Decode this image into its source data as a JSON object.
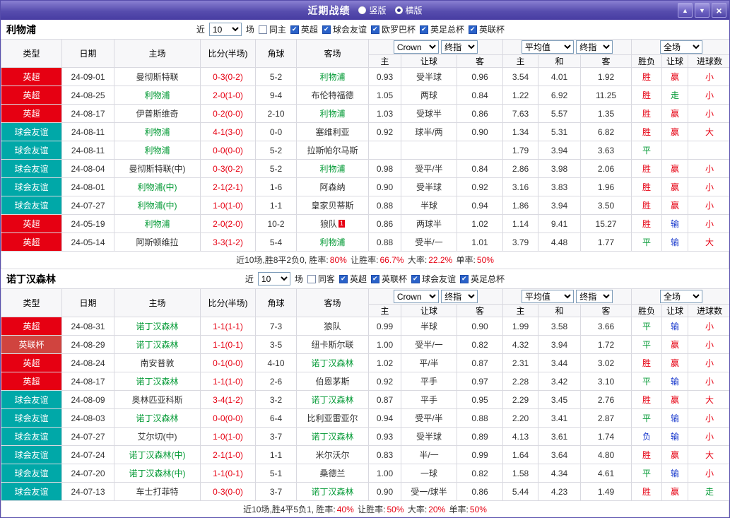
{
  "titlebar": {
    "title": "近期战绩",
    "vertical_label": "竖版",
    "horizontal_label": "横版",
    "selected_layout": "横版"
  },
  "icons": {
    "up": "▲",
    "down": "▼",
    "close": "×"
  },
  "colors": {
    "red": "#e60012",
    "green": "#009933",
    "blue": "#1536cc",
    "teal": "#00a8a8",
    "accent": "#574dae"
  },
  "columns": {
    "type": "类型",
    "date": "日期",
    "home": "主场",
    "score": "比分(半场)",
    "corner": "角球",
    "away": "客场",
    "odds_home": "主",
    "odds_handicap": "让球",
    "odds_away": "客",
    "avg_home": "主",
    "avg_draw": "和",
    "avg_away": "客",
    "result": "胜负",
    "handicap_result": "让球",
    "goals": "进球数"
  },
  "controls": {
    "near_label": "近",
    "near_value": "10",
    "games_label": "场",
    "bookmaker": "Crown",
    "final_index_1": "终指",
    "average": "平均值",
    "final_index_2": "终指",
    "scope": "全场"
  },
  "sections": [
    {
      "team": "利物浦",
      "same_filter": "同主",
      "leagues": [
        "英超",
        "球会友谊",
        "欧罗巴杯",
        "英足总杯",
        "英联杯"
      ],
      "rows": [
        {
          "league": "英超",
          "league_color": "#e60012",
          "date": "24-09-01",
          "home": "曼彻斯特联",
          "home_focus": false,
          "score": "0-3(0-2)",
          "corner": "5-2",
          "away": "利物浦",
          "away_focus": true,
          "away_badge": "",
          "o1": "0.93",
          "hcap": "受半球",
          "o2": "0.96",
          "m1": "3.54",
          "m2": "4.01",
          "m3": "1.92",
          "result": "胜",
          "hres": "赢",
          "goals": "小"
        },
        {
          "league": "英超",
          "league_color": "#e60012",
          "date": "24-08-25",
          "home": "利物浦",
          "home_focus": true,
          "score": "2-0(1-0)",
          "corner": "9-4",
          "away": "布伦特福德",
          "away_focus": false,
          "away_badge": "",
          "o1": "1.05",
          "hcap": "两球",
          "o2": "0.84",
          "m1": "1.22",
          "m2": "6.92",
          "m3": "11.25",
          "result": "胜",
          "hres": "走",
          "goals": "小"
        },
        {
          "league": "英超",
          "league_color": "#e60012",
          "date": "24-08-17",
          "home": "伊普斯维奇",
          "home_focus": false,
          "score": "0-2(0-0)",
          "corner": "2-10",
          "away": "利物浦",
          "away_focus": true,
          "away_badge": "",
          "o1": "1.03",
          "hcap": "受球半",
          "o2": "0.86",
          "m1": "7.63",
          "m2": "5.57",
          "m3": "1.35",
          "result": "胜",
          "hres": "赢",
          "goals": "小"
        },
        {
          "league": "球会友谊",
          "league_color": "#00a8a8",
          "date": "24-08-11",
          "home": "利物浦",
          "home_focus": true,
          "score": "4-1(3-0)",
          "corner": "0-0",
          "away": "塞维利亚",
          "away_focus": false,
          "away_badge": "",
          "o1": "0.92",
          "hcap": "球半/两",
          "o2": "0.90",
          "m1": "1.34",
          "m2": "5.31",
          "m3": "6.82",
          "result": "胜",
          "hres": "赢",
          "goals": "大"
        },
        {
          "league": "球会友谊",
          "league_color": "#00a8a8",
          "date": "24-08-11",
          "home": "利物浦",
          "home_focus": true,
          "score": "0-0(0-0)",
          "corner": "5-2",
          "away": "拉斯帕尔马斯",
          "away_focus": false,
          "away_badge": "",
          "o1": "",
          "hcap": "",
          "o2": "",
          "m1": "1.79",
          "m2": "3.94",
          "m3": "3.63",
          "result": "平",
          "hres": "",
          "goals": ""
        },
        {
          "league": "球会友谊",
          "league_color": "#00a8a8",
          "date": "24-08-04",
          "home": "曼彻斯特联(中)",
          "home_focus": false,
          "score": "0-3(0-2)",
          "corner": "5-2",
          "away": "利物浦",
          "away_focus": true,
          "away_badge": "",
          "o1": "0.98",
          "hcap": "受平/半",
          "o2": "0.84",
          "m1": "2.86",
          "m2": "3.98",
          "m3": "2.06",
          "result": "胜",
          "hres": "赢",
          "goals": "小"
        },
        {
          "league": "球会友谊",
          "league_color": "#00a8a8",
          "date": "24-08-01",
          "home": "利物浦(中)",
          "home_focus": true,
          "score": "2-1(2-1)",
          "corner": "1-6",
          "away": "阿森纳",
          "away_focus": false,
          "away_badge": "",
          "o1": "0.90",
          "hcap": "受半球",
          "o2": "0.92",
          "m1": "3.16",
          "m2": "3.83",
          "m3": "1.96",
          "result": "胜",
          "hres": "赢",
          "goals": "小"
        },
        {
          "league": "球会友谊",
          "league_color": "#00a8a8",
          "date": "24-07-27",
          "home": "利物浦(中)",
          "home_focus": true,
          "score": "1-0(1-0)",
          "corner": "1-1",
          "away": "皇家贝蒂斯",
          "away_focus": false,
          "away_badge": "",
          "o1": "0.88",
          "hcap": "半球",
          "o2": "0.94",
          "m1": "1.86",
          "m2": "3.94",
          "m3": "3.50",
          "result": "胜",
          "hres": "赢",
          "goals": "小"
        },
        {
          "league": "英超",
          "league_color": "#e60012",
          "date": "24-05-19",
          "home": "利物浦",
          "home_focus": true,
          "score": "2-0(2-0)",
          "corner": "10-2",
          "away": "狼队",
          "away_focus": false,
          "away_badge": "1",
          "o1": "0.86",
          "hcap": "两球半",
          "o2": "1.02",
          "m1": "1.14",
          "m2": "9.41",
          "m3": "15.27",
          "result": "胜",
          "hres": "输",
          "goals": "小"
        },
        {
          "league": "英超",
          "league_color": "#e60012",
          "date": "24-05-14",
          "home": "阿斯顿维拉",
          "home_focus": false,
          "score": "3-3(1-2)",
          "corner": "5-4",
          "away": "利物浦",
          "away_focus": true,
          "away_badge": "",
          "o1": "0.88",
          "hcap": "受半/一",
          "o2": "1.01",
          "m1": "3.79",
          "m2": "4.48",
          "m3": "1.77",
          "result": "平",
          "hres": "输",
          "goals": "大"
        }
      ],
      "summary": [
        {
          "text": "近10场,胜8平2负0, 胜率:",
          "red": false
        },
        {
          "text": "80%",
          "red": true
        },
        {
          "text": " 让胜率:",
          "red": false
        },
        {
          "text": "66.7%",
          "red": true
        },
        {
          "text": " 大率:",
          "red": false
        },
        {
          "text": "22.2%",
          "red": true
        },
        {
          "text": " 单率:",
          "red": false
        },
        {
          "text": "50%",
          "red": true
        }
      ]
    },
    {
      "team": "诺丁汉森林",
      "same_filter": "同客",
      "leagues": [
        "英超",
        "英联杯",
        "球会友谊",
        "英足总杯"
      ],
      "rows": [
        {
          "league": "英超",
          "league_color": "#e60012",
          "date": "24-08-31",
          "home": "诺丁汉森林",
          "home_focus": true,
          "score": "1-1(1-1)",
          "corner": "7-3",
          "away": "狼队",
          "away_focus": false,
          "away_badge": "",
          "o1": "0.99",
          "hcap": "半球",
          "o2": "0.90",
          "m1": "1.99",
          "m2": "3.58",
          "m3": "3.66",
          "result": "平",
          "hres": "输",
          "goals": "小"
        },
        {
          "league": "英联杯",
          "league_color": "#d0443f",
          "date": "24-08-29",
          "home": "诺丁汉森林",
          "home_focus": true,
          "score": "1-1(0-1)",
          "corner": "3-5",
          "away": "纽卡斯尔联",
          "away_focus": false,
          "away_badge": "",
          "o1": "1.00",
          "hcap": "受半/一",
          "o2": "0.82",
          "m1": "4.32",
          "m2": "3.94",
          "m3": "1.72",
          "result": "平",
          "hres": "赢",
          "goals": "小"
        },
        {
          "league": "英超",
          "league_color": "#e60012",
          "date": "24-08-24",
          "home": "南安普敦",
          "home_focus": false,
          "score": "0-1(0-0)",
          "corner": "4-10",
          "away": "诺丁汉森林",
          "away_focus": true,
          "away_badge": "",
          "o1": "1.02",
          "hcap": "平/半",
          "o2": "0.87",
          "m1": "2.31",
          "m2": "3.44",
          "m3": "3.02",
          "result": "胜",
          "hres": "赢",
          "goals": "小"
        },
        {
          "league": "英超",
          "league_color": "#e60012",
          "date": "24-08-17",
          "home": "诺丁汉森林",
          "home_focus": true,
          "score": "1-1(1-0)",
          "corner": "2-6",
          "away": "伯恩茅斯",
          "away_focus": false,
          "away_badge": "",
          "o1": "0.92",
          "hcap": "平手",
          "o2": "0.97",
          "m1": "2.28",
          "m2": "3.42",
          "m3": "3.10",
          "result": "平",
          "hres": "输",
          "goals": "小"
        },
        {
          "league": "球会友谊",
          "league_color": "#00a8a8",
          "date": "24-08-09",
          "home": "奥林匹亚科斯",
          "home_focus": false,
          "score": "3-4(1-2)",
          "corner": "3-2",
          "away": "诺丁汉森林",
          "away_focus": true,
          "away_badge": "",
          "o1": "0.87",
          "hcap": "平手",
          "o2": "0.95",
          "m1": "2.29",
          "m2": "3.45",
          "m3": "2.76",
          "result": "胜",
          "hres": "赢",
          "goals": "大"
        },
        {
          "league": "球会友谊",
          "league_color": "#00a8a8",
          "date": "24-08-03",
          "home": "诺丁汉森林",
          "home_focus": true,
          "score": "0-0(0-0)",
          "corner": "6-4",
          "away": "比利亚雷亚尔",
          "away_focus": false,
          "away_badge": "",
          "o1": "0.94",
          "hcap": "受平/半",
          "o2": "0.88",
          "m1": "2.20",
          "m2": "3.41",
          "m3": "2.87",
          "result": "平",
          "hres": "输",
          "goals": "小"
        },
        {
          "league": "球会友谊",
          "league_color": "#00a8a8",
          "date": "24-07-27",
          "home": "艾尔切(中)",
          "home_focus": false,
          "score": "1-0(1-0)",
          "corner": "3-7",
          "away": "诺丁汉森林",
          "away_focus": true,
          "away_badge": "",
          "o1": "0.93",
          "hcap": "受半球",
          "o2": "0.89",
          "m1": "4.13",
          "m2": "3.61",
          "m3": "1.74",
          "result": "负",
          "hres": "输",
          "goals": "小"
        },
        {
          "league": "球会友谊",
          "league_color": "#00a8a8",
          "date": "24-07-24",
          "home": "诺丁汉森林(中)",
          "home_focus": true,
          "score": "2-1(1-0)",
          "corner": "1-1",
          "away": "米尔沃尔",
          "away_focus": false,
          "away_badge": "",
          "o1": "0.83",
          "hcap": "半/一",
          "o2": "0.99",
          "m1": "1.64",
          "m2": "3.64",
          "m3": "4.80",
          "result": "胜",
          "hres": "赢",
          "goals": "大"
        },
        {
          "league": "球会友谊",
          "league_color": "#00a8a8",
          "date": "24-07-20",
          "home": "诺丁汉森林(中)",
          "home_focus": true,
          "score": "1-1(0-1)",
          "corner": "5-1",
          "away": "桑德兰",
          "away_focus": false,
          "away_badge": "",
          "o1": "1.00",
          "hcap": "一球",
          "o2": "0.82",
          "m1": "1.58",
          "m2": "4.34",
          "m3": "4.61",
          "result": "平",
          "hres": "输",
          "goals": "小"
        },
        {
          "league": "球会友谊",
          "league_color": "#00a8a8",
          "date": "24-07-13",
          "home": "车士打菲特",
          "home_focus": false,
          "score": "0-3(0-0)",
          "corner": "3-7",
          "away": "诺丁汉森林",
          "away_focus": true,
          "away_badge": "",
          "o1": "0.90",
          "hcap": "受一/球半",
          "o2": "0.86",
          "m1": "5.44",
          "m2": "4.23",
          "m3": "1.49",
          "result": "胜",
          "hres": "赢",
          "goals": "走"
        }
      ],
      "summary": [
        {
          "text": "近10场,胜4平5负1, 胜率:",
          "red": false
        },
        {
          "text": "40%",
          "red": true
        },
        {
          "text": " 让胜率:",
          "red": false
        },
        {
          "text": "50%",
          "red": true
        },
        {
          "text": " 大率:",
          "red": false
        },
        {
          "text": "20%",
          "red": true
        },
        {
          "text": " 单率:",
          "red": false
        },
        {
          "text": "50%",
          "red": true
        }
      ]
    }
  ]
}
